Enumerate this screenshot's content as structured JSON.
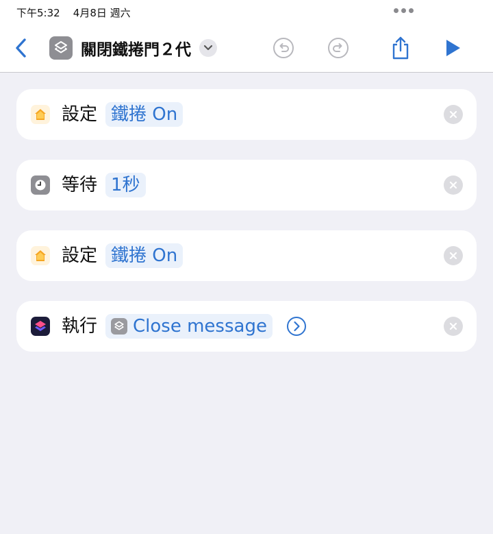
{
  "status": {
    "time": "下午5:32",
    "date": "4月8日 週六"
  },
  "header": {
    "title": "關閉鐵捲門２代",
    "back_icon": "chevron-left-icon",
    "title_icon": "shortcut-layers-icon",
    "undo_icon": "undo-icon",
    "redo_icon": "redo-icon",
    "share_icon": "share-icon",
    "run_icon": "play-icon"
  },
  "actions": [
    {
      "icon": "home-icon",
      "verb": "設定",
      "param": "鐵捲 On"
    },
    {
      "icon": "clock-icon",
      "verb": "等待",
      "param": "1秒"
    },
    {
      "icon": "home-icon",
      "verb": "設定",
      "param": "鐵捲 On"
    },
    {
      "icon": "shortcuts-icon",
      "verb": "執行",
      "param": "Close message"
    }
  ],
  "colors": {
    "accent": "#2f74d0",
    "background": "#f0f0f6",
    "card": "#ffffff",
    "token_bg": "#eaf1fb"
  }
}
